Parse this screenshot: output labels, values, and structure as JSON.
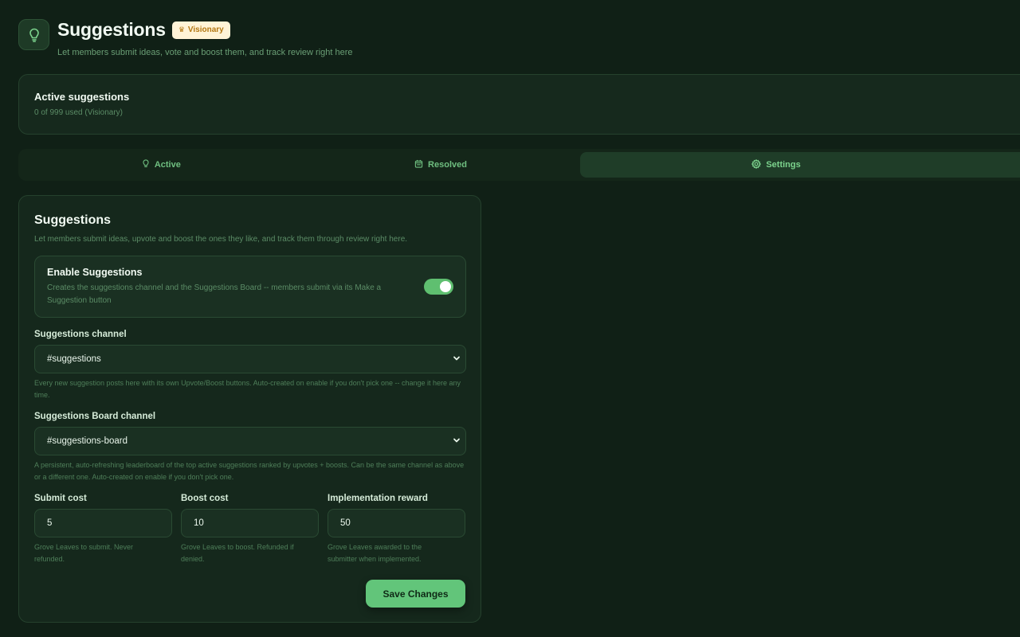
{
  "header": {
    "title": "Suggestions",
    "badge": "Visionary",
    "subtitle": "Let members submit ideas, vote and boost them, and track review right here",
    "icon": "lightbulb-icon",
    "badge_icon": "crown-icon"
  },
  "usage": {
    "title": "Active suggestions",
    "subtitle": "0 of 999 used (Visionary)"
  },
  "tabs": [
    {
      "label": "Active",
      "icon": "lightbulb-icon",
      "active": false
    },
    {
      "label": "Resolved",
      "icon": "calendar-icon",
      "active": false
    },
    {
      "label": "Settings",
      "icon": "gear-icon",
      "active": true
    }
  ],
  "panel": {
    "title": "Suggestions",
    "description": "Let members submit ideas, upvote and boost the ones they like, and track them through review right here.",
    "enable": {
      "title": "Enable Suggestions",
      "description": "Creates the suggestions channel and the Suggestions Board -- members submit via its Make a Suggestion button",
      "enabled": true
    },
    "channel": {
      "label": "Suggestions channel",
      "value": "#suggestions",
      "helper": "Every new suggestion posts here with its own Upvote/Boost buttons. Auto-created on enable if you don't pick one -- change it here any time."
    },
    "board_channel": {
      "label": "Suggestions Board channel",
      "value": "#suggestions-board",
      "helper": "A persistent, auto-refreshing leaderboard of the top active suggestions ranked by upvotes + boosts. Can be the same channel as above or a different one. Auto-created on enable if you don't pick one."
    },
    "submit_cost": {
      "label": "Submit cost",
      "value": "5",
      "helper": "Grove Leaves to submit. Never refunded."
    },
    "boost_cost": {
      "label": "Boost cost",
      "value": "10",
      "helper": "Grove Leaves to boost. Refunded if denied."
    },
    "implementation_reward": {
      "label": "Implementation reward",
      "value": "50",
      "helper": "Grove Leaves awarded to the submitter when implemented."
    },
    "save_label": "Save Changes"
  },
  "colors": {
    "background": "#102016",
    "card": "#15281c",
    "accent": "#62c57a",
    "badge_bg": "#fff3d6",
    "badge_text": "#b37712"
  }
}
